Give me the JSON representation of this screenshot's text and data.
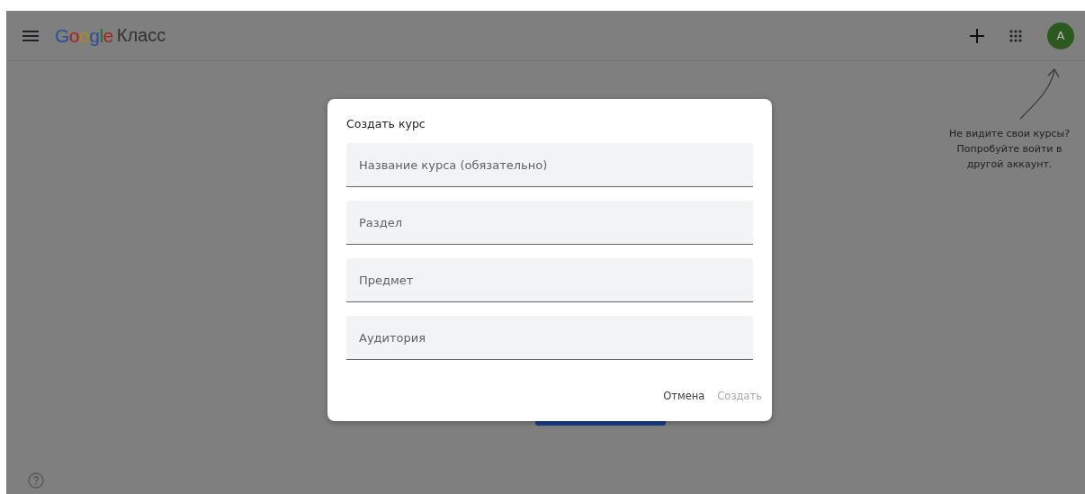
{
  "header": {
    "logo_brand": "Google",
    "logo_product": "Класс",
    "avatar": "A"
  },
  "hint": "Не видите свои курсы? Попробуйте войти в другой аккаунт.",
  "dialog": {
    "title": "Создать курс",
    "fields": [
      {
        "placeholder": "Название курса (обязательно)"
      },
      {
        "placeholder": "Раздел"
      },
      {
        "placeholder": "Предмет"
      },
      {
        "placeholder": "Аудитория"
      }
    ],
    "buttons": [
      {
        "label": "Отмена",
        "disabled": false
      },
      {
        "label": "Создать",
        "disabled": true
      }
    ]
  }
}
